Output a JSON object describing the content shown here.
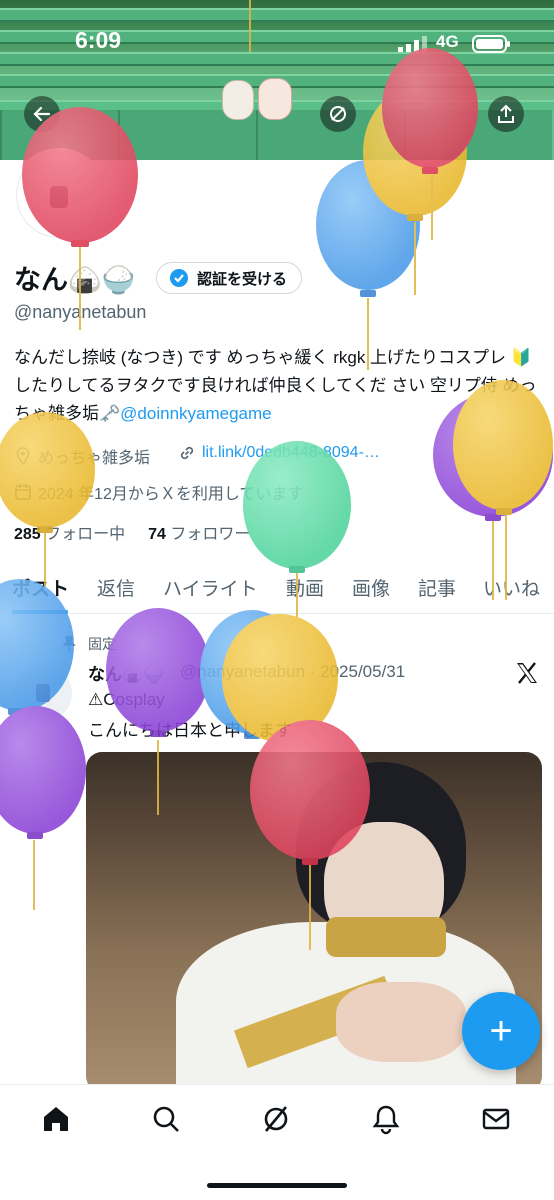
{
  "status_bar": {
    "time": "6:09",
    "network": "4G"
  },
  "profile": {
    "display_name": "なん🍙🍚",
    "verify_label": "認証を受ける",
    "handle": "@nanyanetabun",
    "bio_text": "なんだし捺岐 (なつき) です めっちゃ緩く rkgk 上げたりコスプレ 🔰 したりしてるヲタクです良ければ仲良くしてくだ さい 空リプ侍 めっちゃ雑多垢🗝️",
    "bio_mention": "@doinnkyamegame",
    "location": "めっちゃ雑多垢",
    "website": "lit.link/0dedb448-8094-…",
    "joined": "2024 年12月からＸを利用しています",
    "following_count": "285",
    "following_label": "フォロー中",
    "followers_count": "74",
    "followers_label": "フォロワー"
  },
  "tabs": [
    "ポスト",
    "返信",
    "ハイライト",
    "動画",
    "画像",
    "記事",
    "いいね"
  ],
  "post": {
    "pinned_label": "固定",
    "name": "なん🍙🍚",
    "handle_date": "@nanyanetabun · 2025/05/31",
    "line1": "⚠Cosplay",
    "line2": "こんにちは日本と申します"
  },
  "fab_label": "+",
  "colors": {
    "accent": "#1d9bf0",
    "text": "#0f1419",
    "muted": "#536471"
  },
  "icons": {
    "back": "arrow-left-icon",
    "grok": "grok-icon",
    "share": "share-icon",
    "verified": "verified-badge-icon",
    "location": "location-pin-icon",
    "link": "link-icon",
    "calendar": "calendar-icon",
    "x_logo": "x-logo-icon",
    "home": "home-icon",
    "search": "search-icon",
    "notifications": "bell-icon",
    "messages": "mail-icon"
  }
}
